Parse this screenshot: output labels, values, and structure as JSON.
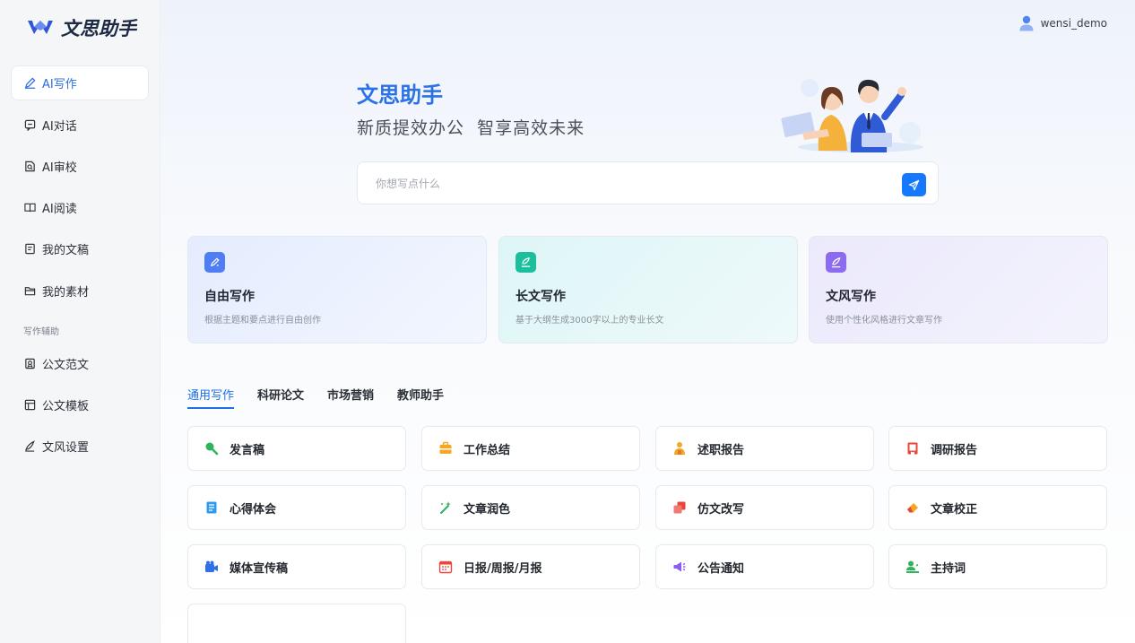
{
  "app": {
    "logo_text": "文思助手"
  },
  "sidebar": {
    "items": [
      {
        "label": "AI写作",
        "icon": "pen-icon"
      },
      {
        "label": "AI对话",
        "icon": "chat-icon"
      },
      {
        "label": "AI审校",
        "icon": "review-icon"
      },
      {
        "label": "AI阅读",
        "icon": "book-icon"
      },
      {
        "label": "我的文稿",
        "icon": "document-icon"
      },
      {
        "label": "我的素材",
        "icon": "folder-icon"
      }
    ],
    "section_label": "写作辅助",
    "assist_items": [
      {
        "label": "公文范文",
        "icon": "sample-icon"
      },
      {
        "label": "公文模板",
        "icon": "template-icon"
      },
      {
        "label": "文风设置",
        "icon": "style-pen-icon"
      }
    ]
  },
  "header": {
    "username": "wensi_demo"
  },
  "hero": {
    "title": "文思助手",
    "subtitle": "新质提效办公  智享高效未来"
  },
  "search": {
    "placeholder": "你想写点什么",
    "value": ""
  },
  "features": [
    {
      "title": "自由写作",
      "desc": "根据主题和要点进行自由创作",
      "icon_color": "#4f7df3"
    },
    {
      "title": "长文写作",
      "desc": "基于大纲生成3000字以上的专业长文",
      "icon_color": "#1bbf9b"
    },
    {
      "title": "文风写作",
      "desc": "使用个性化风格进行文章写作",
      "icon_color": "#8b6cf0"
    }
  ],
  "tabs": [
    "通用写作",
    "科研论文",
    "市场营销",
    "教师助手"
  ],
  "templates": [
    {
      "label": "发言稿",
      "icon": "microphone-icon"
    },
    {
      "label": "工作总结",
      "icon": "briefcase-icon"
    },
    {
      "label": "述职报告",
      "icon": "presenter-icon"
    },
    {
      "label": "调研报告",
      "icon": "report-book-icon"
    },
    {
      "label": "心得体会",
      "icon": "notes-icon"
    },
    {
      "label": "文章润色",
      "icon": "magic-wand-icon"
    },
    {
      "label": "仿文改写",
      "icon": "copy-icon"
    },
    {
      "label": "文章校正",
      "icon": "eraser-icon"
    },
    {
      "label": "媒体宣传稿",
      "icon": "video-camera-icon"
    },
    {
      "label": "日报/周报/月报",
      "icon": "calendar-icon"
    },
    {
      "label": "公告通知",
      "icon": "megaphone-icon"
    },
    {
      "label": "主持词",
      "icon": "host-icon"
    }
  ]
}
